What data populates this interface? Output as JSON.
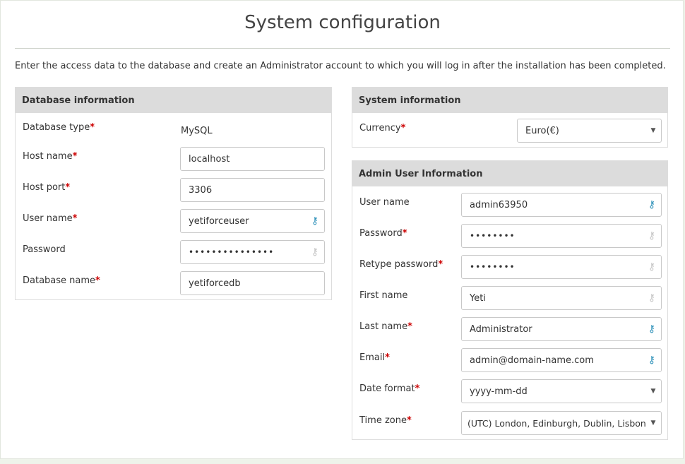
{
  "title": "System configuration",
  "intro": "Enter the access data to the database and create an Administrator account to which you will log in after the installation has been completed.",
  "db": {
    "heading": "Database information",
    "type": {
      "label": "Database type",
      "value": "MySQL"
    },
    "host": {
      "label": "Host name",
      "value": "localhost"
    },
    "port": {
      "label": "Host port",
      "value": "3306"
    },
    "user": {
      "label": "User name",
      "value": "yetiforceuser"
    },
    "password": {
      "label": "Password",
      "value": "•••••••••••••••"
    },
    "name": {
      "label": "Database name",
      "value": "yetiforcedb"
    }
  },
  "system": {
    "heading": "System information",
    "currency": {
      "label": "Currency",
      "value": "Euro(€)"
    }
  },
  "admin": {
    "heading": "Admin User Information",
    "username": {
      "label": "User name",
      "value": "admin63950"
    },
    "password": {
      "label": "Password",
      "value": "••••••••"
    },
    "retype": {
      "label": "Retype password",
      "value": "••••••••"
    },
    "firstname": {
      "label": "First name",
      "value": "Yeti"
    },
    "lastname": {
      "label": "Last name",
      "value": "Administrator"
    },
    "email": {
      "label": "Email",
      "value": "admin@domain-name.com"
    },
    "dateformat": {
      "label": "Date format",
      "value": "yyyy-mm-dd"
    },
    "timezone": {
      "label": "Time zone",
      "value": "(UTC) London, Edinburgh, Dublin, Lisbon"
    }
  },
  "required_mark": "*",
  "icons": {
    "key": "key-icon",
    "dropdown": "caret-down-icon"
  },
  "colors": {
    "header_bg": "#dcdcdc",
    "required": "#cc0000",
    "key_active": "#2a8fb8",
    "key_faded": "#c4c4c4"
  }
}
